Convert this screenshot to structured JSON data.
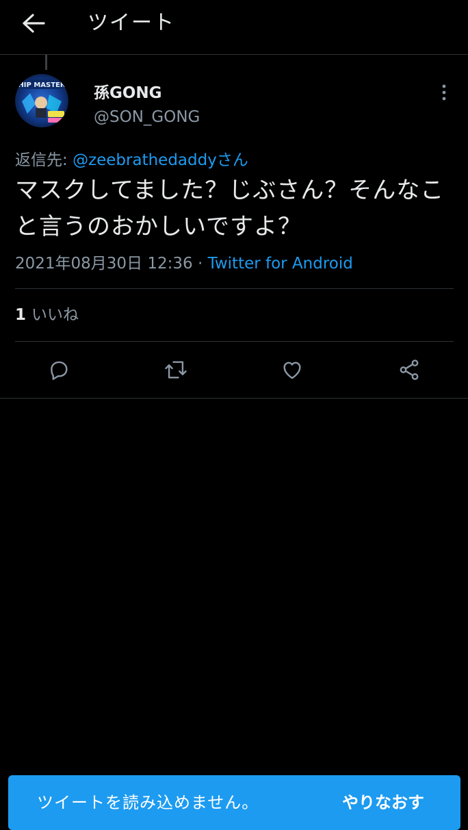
{
  "header": {
    "title": "ツイート",
    "back_icon": "arrow-left-icon"
  },
  "author": {
    "display_name": "孫GONG",
    "handle": "@SON_GONG",
    "avatar_text": "HIP MASTER"
  },
  "tweet": {
    "reply_prefix": "返信先: ",
    "reply_mention": "@zeebrathedaddyさん",
    "text": "マスクしてました？じぶさん？そんなこと言うのおかしいですよ？",
    "timestamp": "2021年08月30日 12:36",
    "separator": " · ",
    "source": "Twitter for Android"
  },
  "stats": {
    "like_count": "1",
    "like_label": "いいね"
  },
  "actions": {
    "reply_icon": "reply-icon",
    "retweet_icon": "retweet-icon",
    "like_icon": "heart-icon",
    "share_icon": "share-icon"
  },
  "toast": {
    "message": "ツイートを読み込めません。",
    "retry_label": "やりなおす"
  },
  "colors": {
    "background": "#000000",
    "text_primary": "#e7e9ea",
    "text_secondary": "#8b98a5",
    "accent": "#1d9bf0",
    "divider": "#2f3336"
  }
}
